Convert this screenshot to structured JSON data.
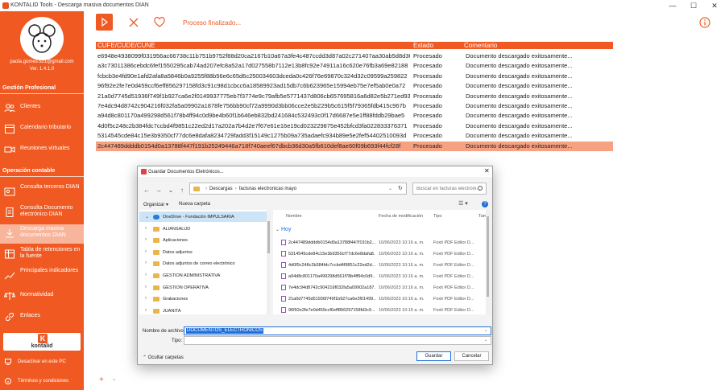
{
  "window": {
    "title": "KONTALID Tools - Descarga masiva documentos DIAN",
    "minimize": "—",
    "maximize": "☐",
    "close": "✕"
  },
  "sidebar": {
    "email": "paola.gomes.s21@gmail.com",
    "version": "Ver. 1.4.1.0",
    "section1": "Gestión Profesional",
    "section1_items": [
      {
        "label": "Clientes",
        "icon": "people-icon"
      },
      {
        "label": "Calendario tributario",
        "icon": "calendar-icon"
      },
      {
        "label": "Reuniones virtuales",
        "icon": "video-icon"
      }
    ],
    "section2": "Operación contable",
    "section2_items": [
      {
        "label": "Consulta terceros DIAN",
        "icon": "id-card-icon"
      },
      {
        "label": "Consulta Documento electrónico DIAN",
        "icon": "document-icon"
      },
      {
        "label": "Descarga masiva documentos DIAN",
        "icon": "download-icon"
      },
      {
        "label": "Tabla de retenciones en la fuente",
        "icon": "table-icon"
      },
      {
        "label": "Principales indicadores",
        "icon": "chart-icon"
      },
      {
        "label": "Normatividad",
        "icon": "scale-icon"
      },
      {
        "label": "Enlaces",
        "icon": "link-icon"
      }
    ],
    "logo_text": "kontalid",
    "bottom_items": [
      {
        "label": "Desactivar en este PC",
        "icon": "monitor-icon"
      },
      {
        "label": "Términos y condiciones",
        "icon": "info-icon"
      }
    ]
  },
  "toolbar": {
    "status": "Proceso finalizado..."
  },
  "table": {
    "headers": [
      "CUFE/CUDE/CUNE",
      "Estado",
      "Comentario"
    ],
    "rows": [
      [
        "e6948e4938099f031956ac66738c11b751b9752f88d20ca2167b10a67a3fe4c487ccdd3d87a02c271407aa30ab5d8d36",
        "Procesado",
        "Documento descargado exitosamente..."
      ],
      [
        "a3c73011386cebdc6fef1550295cab74ad207efc8a52a17d027558b7112e13b8fc92e74911a16c620e76fb3a69e82188",
        "Procesado",
        "Documento descargado exitosamente..."
      ],
      [
        "fcbcb3e4fd90e1afd2afa8a5846b0a9255f88b56e6c65d6c250034603dceda0c426f76e69870c324d32c09599a259822",
        "Procesado",
        "Documento descargado exitosamente..."
      ],
      [
        "96f92e2fe7e0d459ccf6eff856297158fd3c91c98d1cbcc6a18589923ad15db7c6b623965e15994eb75e7ef5ab0e0a72",
        "Procesado",
        "Documento descargado exitosamente..."
      ],
      [
        "21a0d7745d51936f749f1b927ca6e2f0149937775eb7f3774e9c79afb5e5771437d806cb657695816a6d82e5b271ed93",
        "Procesado",
        "Documento descargado exitosamente..."
      ],
      [
        "7e4dc94d8742c904216f032fa5a09902a1878fe756bb90cf72a9990d3bb06cce2e5b229b5c615f5f79365fdb415c967b",
        "Procesado",
        "Documento descargado exitosamente..."
      ],
      [
        "a94d8c801170a499298d561f78b4ff94c0d9be4b60f1b646eb832bd241684c532493c0f17d6687e5e1ff88fddb29bae5",
        "Procesado",
        "Documento descargado exitosamente..."
      ],
      [
        "4d0f5c248c2b384fdc7ccbd4f9851c22ed2d17a202a7b4d2e7f67e61e16e19cd023229875e452bfcd3fa022833376371",
        "Procesado",
        "Documento descargado exitosamente..."
      ],
      [
        "5314545cde84c15e3b9350cf77dc6e8dafa8234729fadd3f15149c1275b09a735adaefc934b89e5e2fef54402510093d",
        "Procesado",
        "Documento descargado exitosamente..."
      ],
      [
        "2c447489ddddb0154d0a13788f447f191b25249446a718f740aeef67dbcb36d30a5fb610def8ae60f09b693f44fcf28f",
        "Procesado",
        "Documento descargado exitosamente..."
      ]
    ],
    "selected_index": 9
  },
  "bottom": {
    "plus": "+",
    "minus": "-"
  },
  "dialog": {
    "title": "Guardar Documentos Eletrónicos...",
    "close": "✕",
    "nav": {
      "back": "←",
      "forward": "→",
      "dropdown": "⌄",
      "up": "↑"
    },
    "breadcrumbs": [
      "Descargas",
      "facturas electronicas mayo"
    ],
    "search_placeholder": "Buscar en facturas electróni...",
    "organize": "Organizar ▾",
    "new_folder": "Nueva carpeta",
    "tree": [
      {
        "label": "OneDrive - Fundación IMPULSARIA",
        "kind": "cloud",
        "chevron": "⌄",
        "selected": true
      },
      {
        "label": "ALIANSALUD",
        "kind": "folder",
        "chevron": "›"
      },
      {
        "label": "Aplicaciones",
        "kind": "folder",
        "chevron": "›"
      },
      {
        "label": "Datos adjuntos",
        "kind": "folder",
        "chevron": "›"
      },
      {
        "label": "Datos adjuntos de correo electrónico",
        "kind": "folder",
        "chevron": "›"
      },
      {
        "label": "GESTION ADMINISTRATIVA",
        "kind": "folder",
        "chevron": "›"
      },
      {
        "label": "GESTION OPERATIVA",
        "kind": "folder",
        "chevron": "›"
      },
      {
        "label": "Grabaciones",
        "kind": "folder",
        "chevron": "›"
      },
      {
        "label": "JUANITA",
        "kind": "folder",
        "chevron": "›"
      }
    ],
    "columns": [
      "Nombre",
      "Fecha de modificación",
      "Tipo",
      "Tam"
    ],
    "group": "Hoy",
    "group_chevron": "⌄",
    "files": [
      {
        "name": "2c447489ddddb0154d0a13788f447f191b2...",
        "date": "10/06/2023 10:16 a. m.",
        "type": "Foxit PDF Editor D..."
      },
      {
        "name": "5314545cde84c15e3b9350cf77dc6e8dafa8...",
        "date": "10/06/2023 10:16 a. m.",
        "type": "Foxit PDF Editor D..."
      },
      {
        "name": "4d0f5c248c2b384fdc7ccbd4f9851c22ed2d...",
        "date": "10/06/2023 10:16 a. m.",
        "type": "Foxit PDF Editor D..."
      },
      {
        "name": "a94d8c801170a499298d561f78b4ff94c0d9...",
        "date": "10/06/2023 10:16 a. m.",
        "type": "Foxit PDF Editor D..."
      },
      {
        "name": "7e4dc94d8742c904216f032fa5a09902a187...",
        "date": "10/06/2023 10:16 a. m.",
        "type": "Foxit PDF Editor D..."
      },
      {
        "name": "21a0d7745d51936f749f1b927ca6e2f01499...",
        "date": "10/06/2023 10:16 a. m.",
        "type": "Foxit PDF Editor D..."
      },
      {
        "name": "96f92e2fe7e0d459ccf6eff856297158fd3c9...",
        "date": "10/06/2023 10:16 a. m.",
        "type": "Foxit PDF Editor D..."
      }
    ],
    "filename_label": "Nombre de archivo:",
    "filename_value": "DOCUMENTOS_ELECTRONICOS",
    "type_label": "Tipo:",
    "type_value": "",
    "hide_folders": "⌃ Ocultar carpetas",
    "save": "Guardar",
    "cancel": "Cancelar"
  },
  "colors": {
    "accent": "#f05a22",
    "selected_row": "#f5a182",
    "active_nav": "#f7b59c"
  }
}
